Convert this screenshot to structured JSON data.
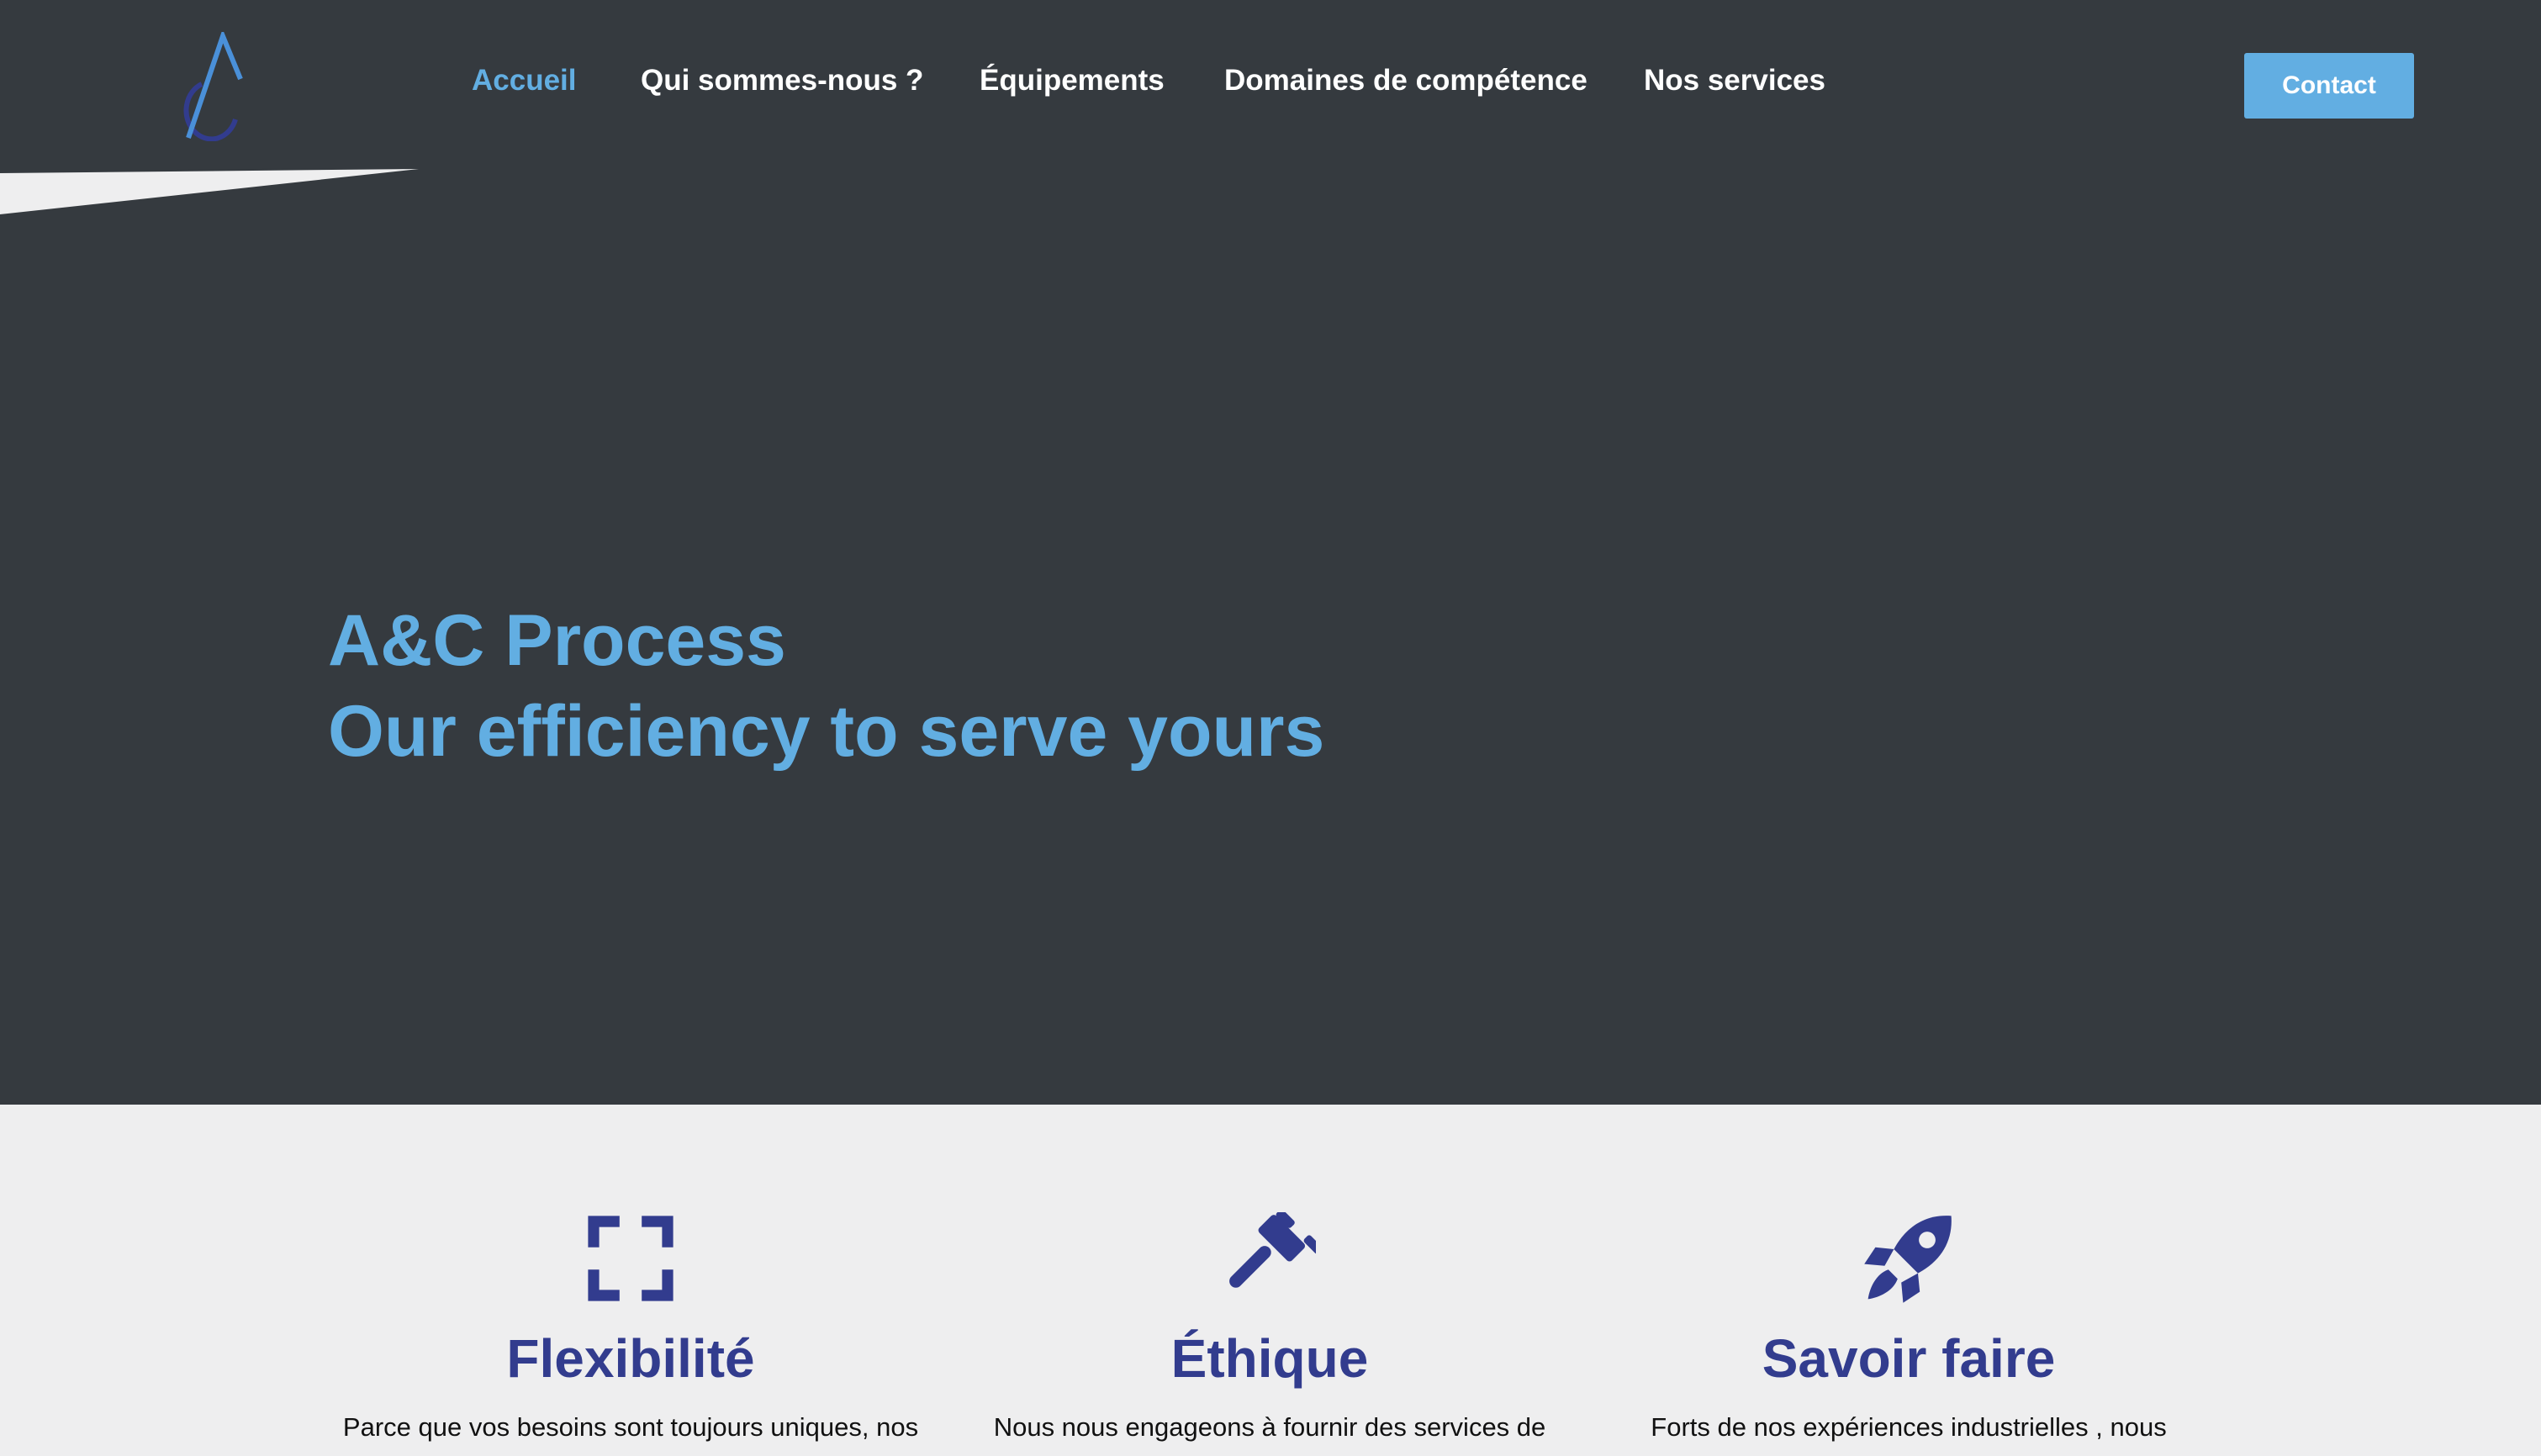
{
  "nav": {
    "items": [
      {
        "label": "Accueil",
        "active": true
      },
      {
        "label": "Qui sommes-nous ?",
        "active": false
      },
      {
        "label": "Équipements",
        "active": false
      },
      {
        "label": "Domaines de compétence",
        "active": false
      },
      {
        "label": "Nos services",
        "active": false
      }
    ],
    "contact_label": "Contact"
  },
  "hero": {
    "line1": "A&C Process",
    "line2": "Our efficiency to serve yours"
  },
  "features": [
    {
      "icon": "expand-icon",
      "title": "Flexibilité",
      "text": "Parce que vos besoins sont toujours uniques, nos"
    },
    {
      "icon": "gavel-icon",
      "title": "Éthique",
      "text": "Nous nous engageons à fournir des services de"
    },
    {
      "icon": "rocket-icon",
      "title": "Savoir faire",
      "text": "Forts de nos expériences industrielles , nous"
    }
  ],
  "colors": {
    "background": "#353a3f",
    "accent": "#62aee2",
    "feature_title": "#323c8e",
    "features_background": "#eeeeef"
  }
}
